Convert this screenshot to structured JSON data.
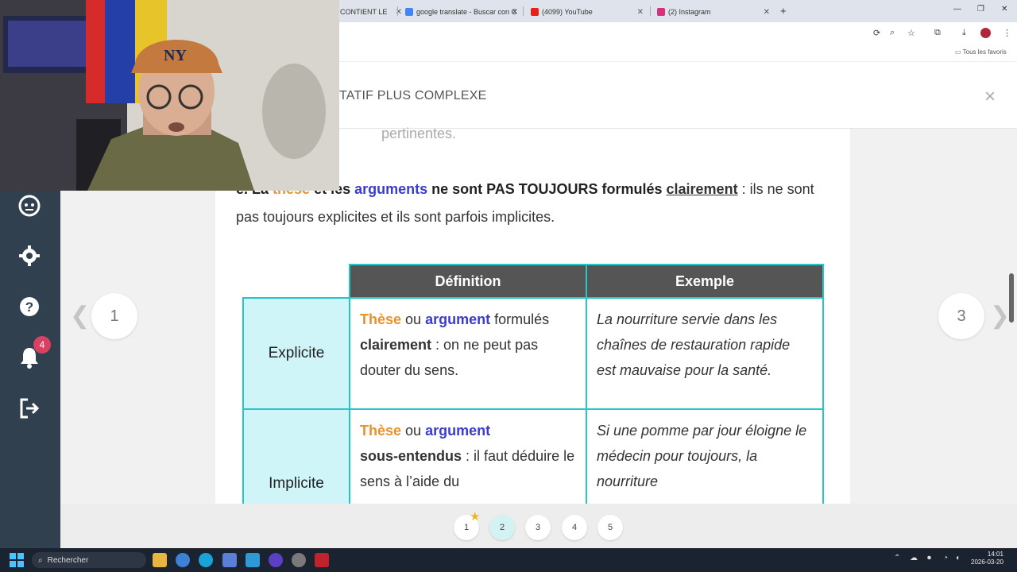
{
  "browser": {
    "tabs": [
      {
        "title": "CONTIENT LE"
      },
      {
        "title": "google translate - Buscar con G"
      },
      {
        "title": "(4099) YouTube"
      },
      {
        "title": "(2) Instagram"
      }
    ],
    "new_tab": "+",
    "bookmarks_label": "Tous les favoris"
  },
  "lesson": {
    "title": "TATIF PLUS COMPLEXE",
    "close": "×",
    "faded_text": "pertinentes.",
    "para": {
      "prefix": "e. La ",
      "these": "thèse",
      "et_les": " et les ",
      "arguments": "arguments",
      "mid": " ne sont PAS TOUJOURS formulés ",
      "clairement": "clairement",
      "end": " : ils ne sont pas toujours explicites et ils sont parfois implicites."
    },
    "table": {
      "headers": [
        "Définition",
        "Exemple"
      ],
      "rows": [
        {
          "label": "Explicite",
          "def_these": "Thèse",
          "def_ou": " ou ",
          "def_argument": "argument",
          "def_formules": " formulés ",
          "def_key": "clairement",
          "def_rest": " : on ne peut pas douter du sens.",
          "example": "La nourriture servie dans les chaînes de restauration rapide est mauvaise pour la santé."
        },
        {
          "label": "Implicite",
          "def_these": "Thèse",
          "def_ou": " ou ",
          "def_argument": "argument",
          "def_key": "sous-entendus",
          "def_rest": " : il faut déduire le sens à l’aide du",
          "example": "Si une pomme par jour éloigne le médecin pour toujours, la nourriture"
        }
      ]
    }
  },
  "page_nav": {
    "prev_arrow": "❮",
    "prev_page": "1",
    "next_page": "3",
    "next_arrow": "❯"
  },
  "pagination": [
    "1",
    "2",
    "3",
    "4",
    "5"
  ],
  "pagination_active": 2,
  "sidebar": {
    "notifications_count": "4",
    "icons": [
      "robot-face-icon",
      "gear-icon",
      "help-icon",
      "bell-icon",
      "logout-icon"
    ]
  },
  "taskbar": {
    "search_placeholder": "Rechercher",
    "time": "14:01",
    "date": "2026-03-20"
  },
  "colors": {
    "teal_border": "#25c5c8",
    "header_gray": "#555555",
    "orange": "#e8922b",
    "blue": "#3a3ad4",
    "sidebar": "#31404f"
  }
}
